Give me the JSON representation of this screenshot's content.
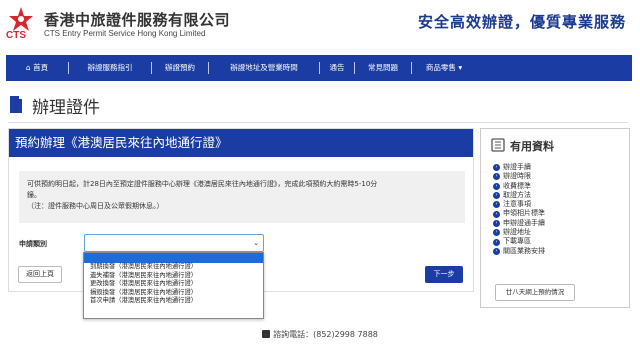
{
  "header": {
    "logo_text": "CTS",
    "company_cn": "香港中旅證件服務有限公司",
    "company_en": "CTS Entry Permit Service Hong Kong Limited",
    "slogan": "安全高效辦證，優質專業服務",
    "brand_color": "#1b3da3",
    "logo_color": "#d8262f"
  },
  "nav": {
    "items": [
      {
        "label": "首頁",
        "icon": "home-icon"
      },
      {
        "label": "辦證服務指引"
      },
      {
        "label": "辦證預約"
      },
      {
        "label": "辦證地址及營業時間"
      },
      {
        "label": "通告"
      },
      {
        "label": "常見問題"
      },
      {
        "label": "商品零售"
      }
    ],
    "dropdown_caret": "▾"
  },
  "page": {
    "title": "辦理證件"
  },
  "panel": {
    "header": "預約辦理《港澳居民來往內地通行證》",
    "notice_line1": "可供預約明日起，計28日內至預定證件服務中心辦理《港澳居民來往內地通行證》，完成此項預約大約需時5-10分",
    "notice_line2": "鐘。",
    "notice_line3": "（注：證件服務中心周日及公眾假期休息。）",
    "form_label": "申請類別",
    "select_value": "",
    "back_label": "返回上頁",
    "next_label": "下一步"
  },
  "dropdown": {
    "options": [
      "",
      "到期換發（港澳居民來往內地通行證）",
      "遺失補發（港澳居民來往內地通行證）",
      "更改換發（港澳居民來往內地通行證）",
      "損毀換發（港澳居民來往內地通行證）",
      "首次申請（港澳居民來往內地通行證）"
    ],
    "selected_index": 0
  },
  "sidebar": {
    "title": "有用資料",
    "items": [
      "辦證手續",
      "辦證時限",
      "收費標準",
      "取證方法",
      "注意事項",
      "申領相片標準",
      "申辦證通手續",
      "辦證地址",
      "下載專區",
      "關區業務安排"
    ],
    "button_label": "廿八天網上預約情況"
  },
  "footer": {
    "phone_text": "諮詢電話：(852)2998 7888"
  }
}
